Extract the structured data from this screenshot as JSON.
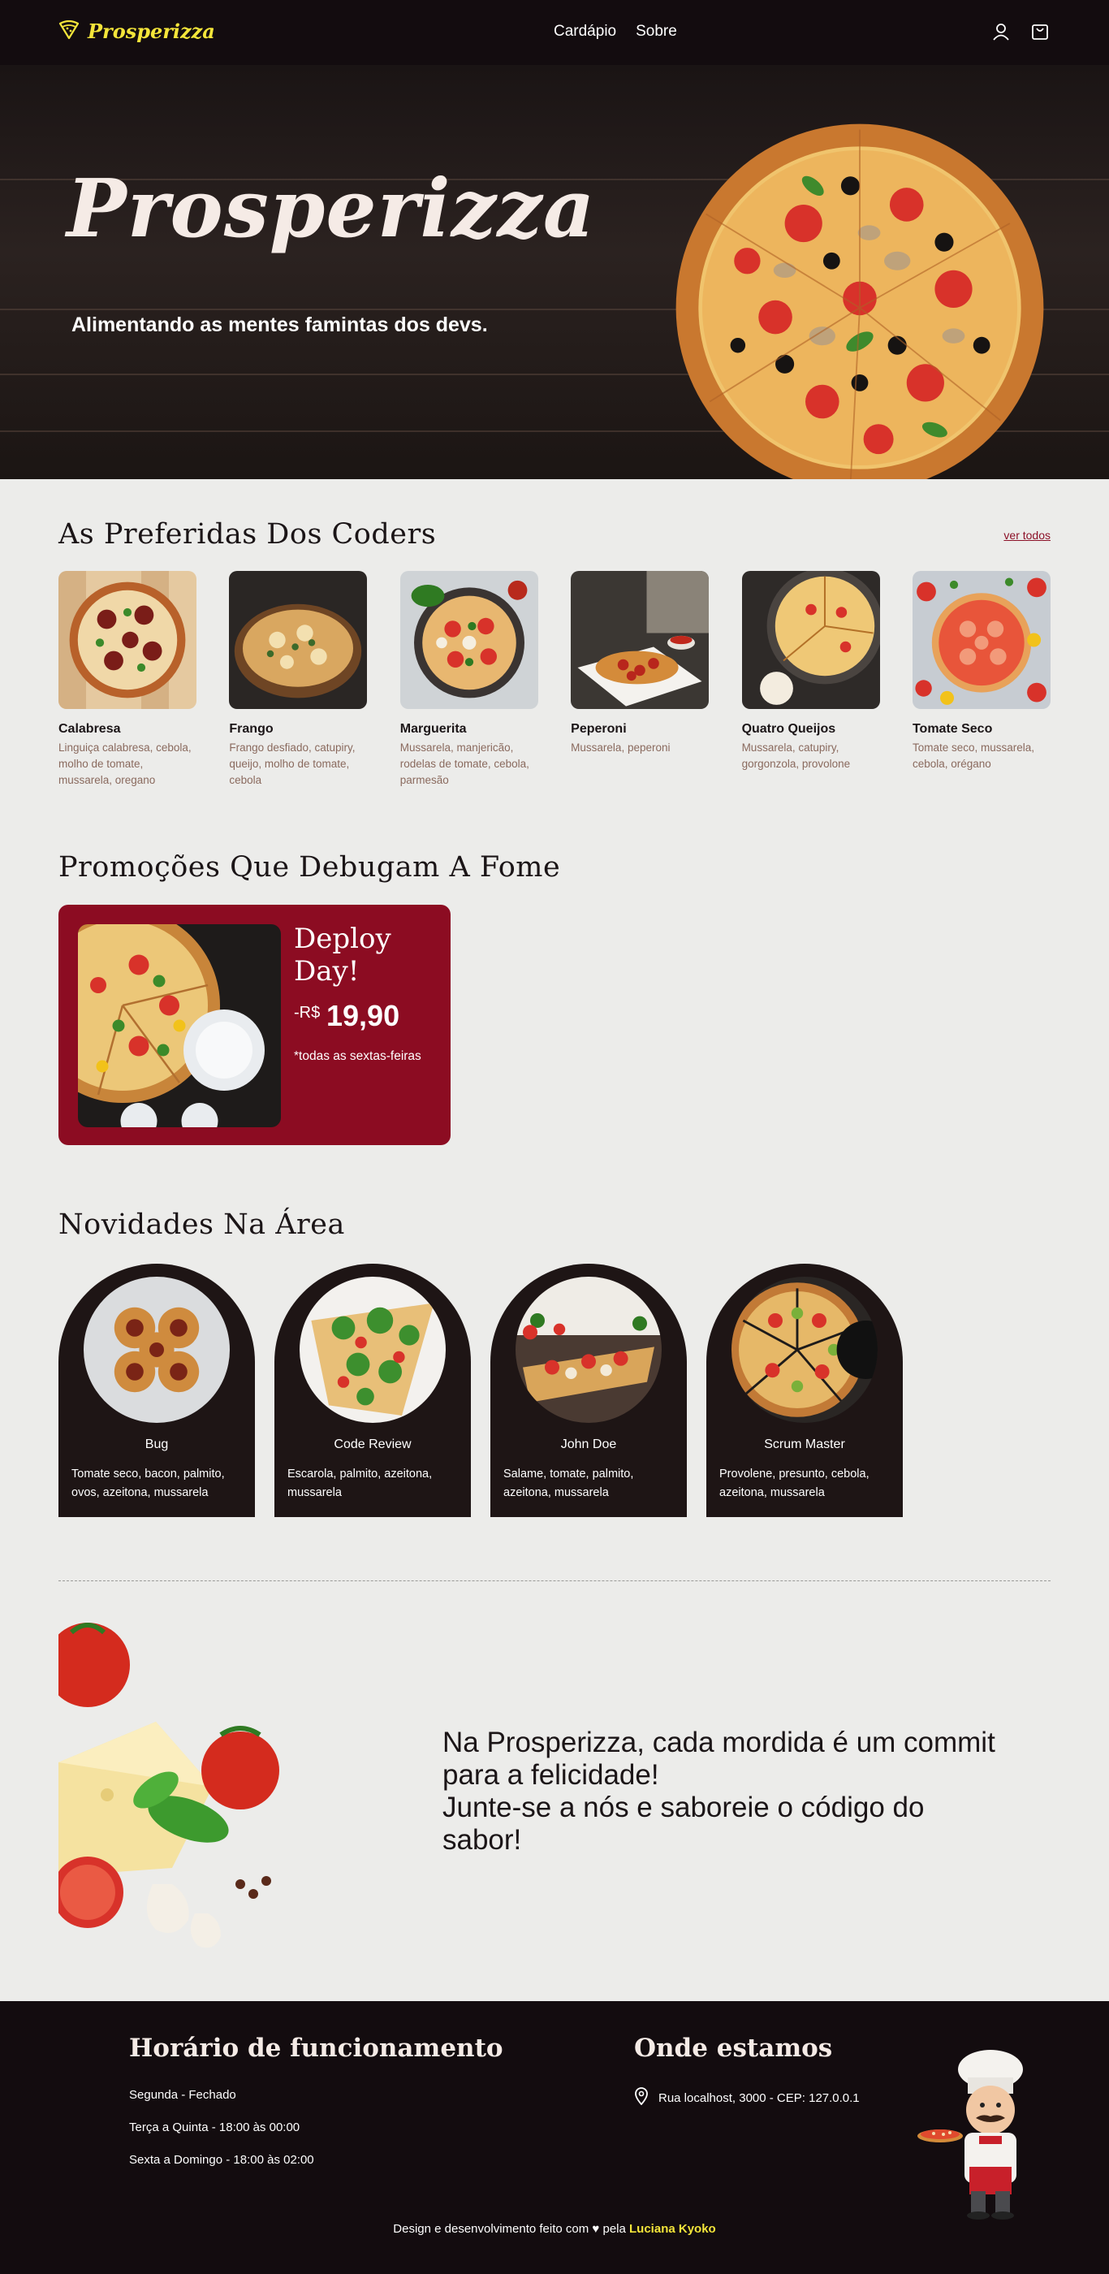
{
  "header": {
    "logo_text": "Prosperizza",
    "nav": [
      {
        "label": "Cardápio"
      },
      {
        "label": "Sobre"
      }
    ],
    "icons": [
      "user-icon",
      "cart-icon"
    ]
  },
  "hero": {
    "title": "Prosperizza",
    "subtitle": "Alimentando as mentes famintas dos devs."
  },
  "favorites": {
    "title": "As Preferidas Dos Coders",
    "see_all": "ver todos",
    "items": [
      {
        "name": "Calabresa",
        "description": "Linguiça calabresa, cebola, molho de tomate, mussarela, oregano"
      },
      {
        "name": "Frango",
        "description": "Frango desfiado, catupiry, queijo, molho de tomate, cebola"
      },
      {
        "name": "Marguerita",
        "description": "Mussarela, manjericão, rodelas de tomate, cebola, parmesão"
      },
      {
        "name": "Peperoni",
        "description": "Mussarela, peperoni"
      },
      {
        "name": "Quatro Queijos",
        "description": "Mussarela, catupiry, gorgonzola, provolone"
      },
      {
        "name": "Tomate Seco",
        "description": "Tomate seco, mussarela, cebola, orégano"
      }
    ]
  },
  "promotions": {
    "title": "Promoções Que Debugam A Fome",
    "card": {
      "title": "Deploy Day!",
      "currency": "-R$",
      "price": "19,90",
      "note": "*todas as sextas-feiras"
    }
  },
  "news": {
    "title": "Novidades Na Área",
    "items": [
      {
        "name": "Bug",
        "description": "Tomate seco, bacon, palmito, ovos, azeitona, mussarela"
      },
      {
        "name": "Code Review",
        "description": "Escarola, palmito, azeitona, mussarela"
      },
      {
        "name": "John Doe",
        "description": "Salame, tomate, palmito, azeitona, mussarela"
      },
      {
        "name": "Scrum Master",
        "description": "Provolene, presunto, cebola, azeitona, mussarela"
      }
    ]
  },
  "slogan": {
    "line1": "Na Prosperizza, cada mordida é um commit para a felicidade!",
    "line2": "Junte-se a nós e saboreie o código do sabor!"
  },
  "footer": {
    "hours_title": "Horário de funcionamento",
    "hours": [
      "Segunda - Fechado",
      "Terça a Quinta - 18:00 às 00:00",
      "Sexta a Domingo - 18:00 às 02:00"
    ],
    "location_title": "Onde estamos",
    "address": "Rua localhost, 3000 - CEP: 127.0.0.1",
    "credits_prefix": "Design e desenvolvimento feito com ♥ pela",
    "author": "Luciana Kyoko"
  },
  "colors": {
    "dark": "#130c0f",
    "promo": "#8c0c22",
    "accent_yellow": "#f4e53a",
    "background": "#ececea"
  }
}
